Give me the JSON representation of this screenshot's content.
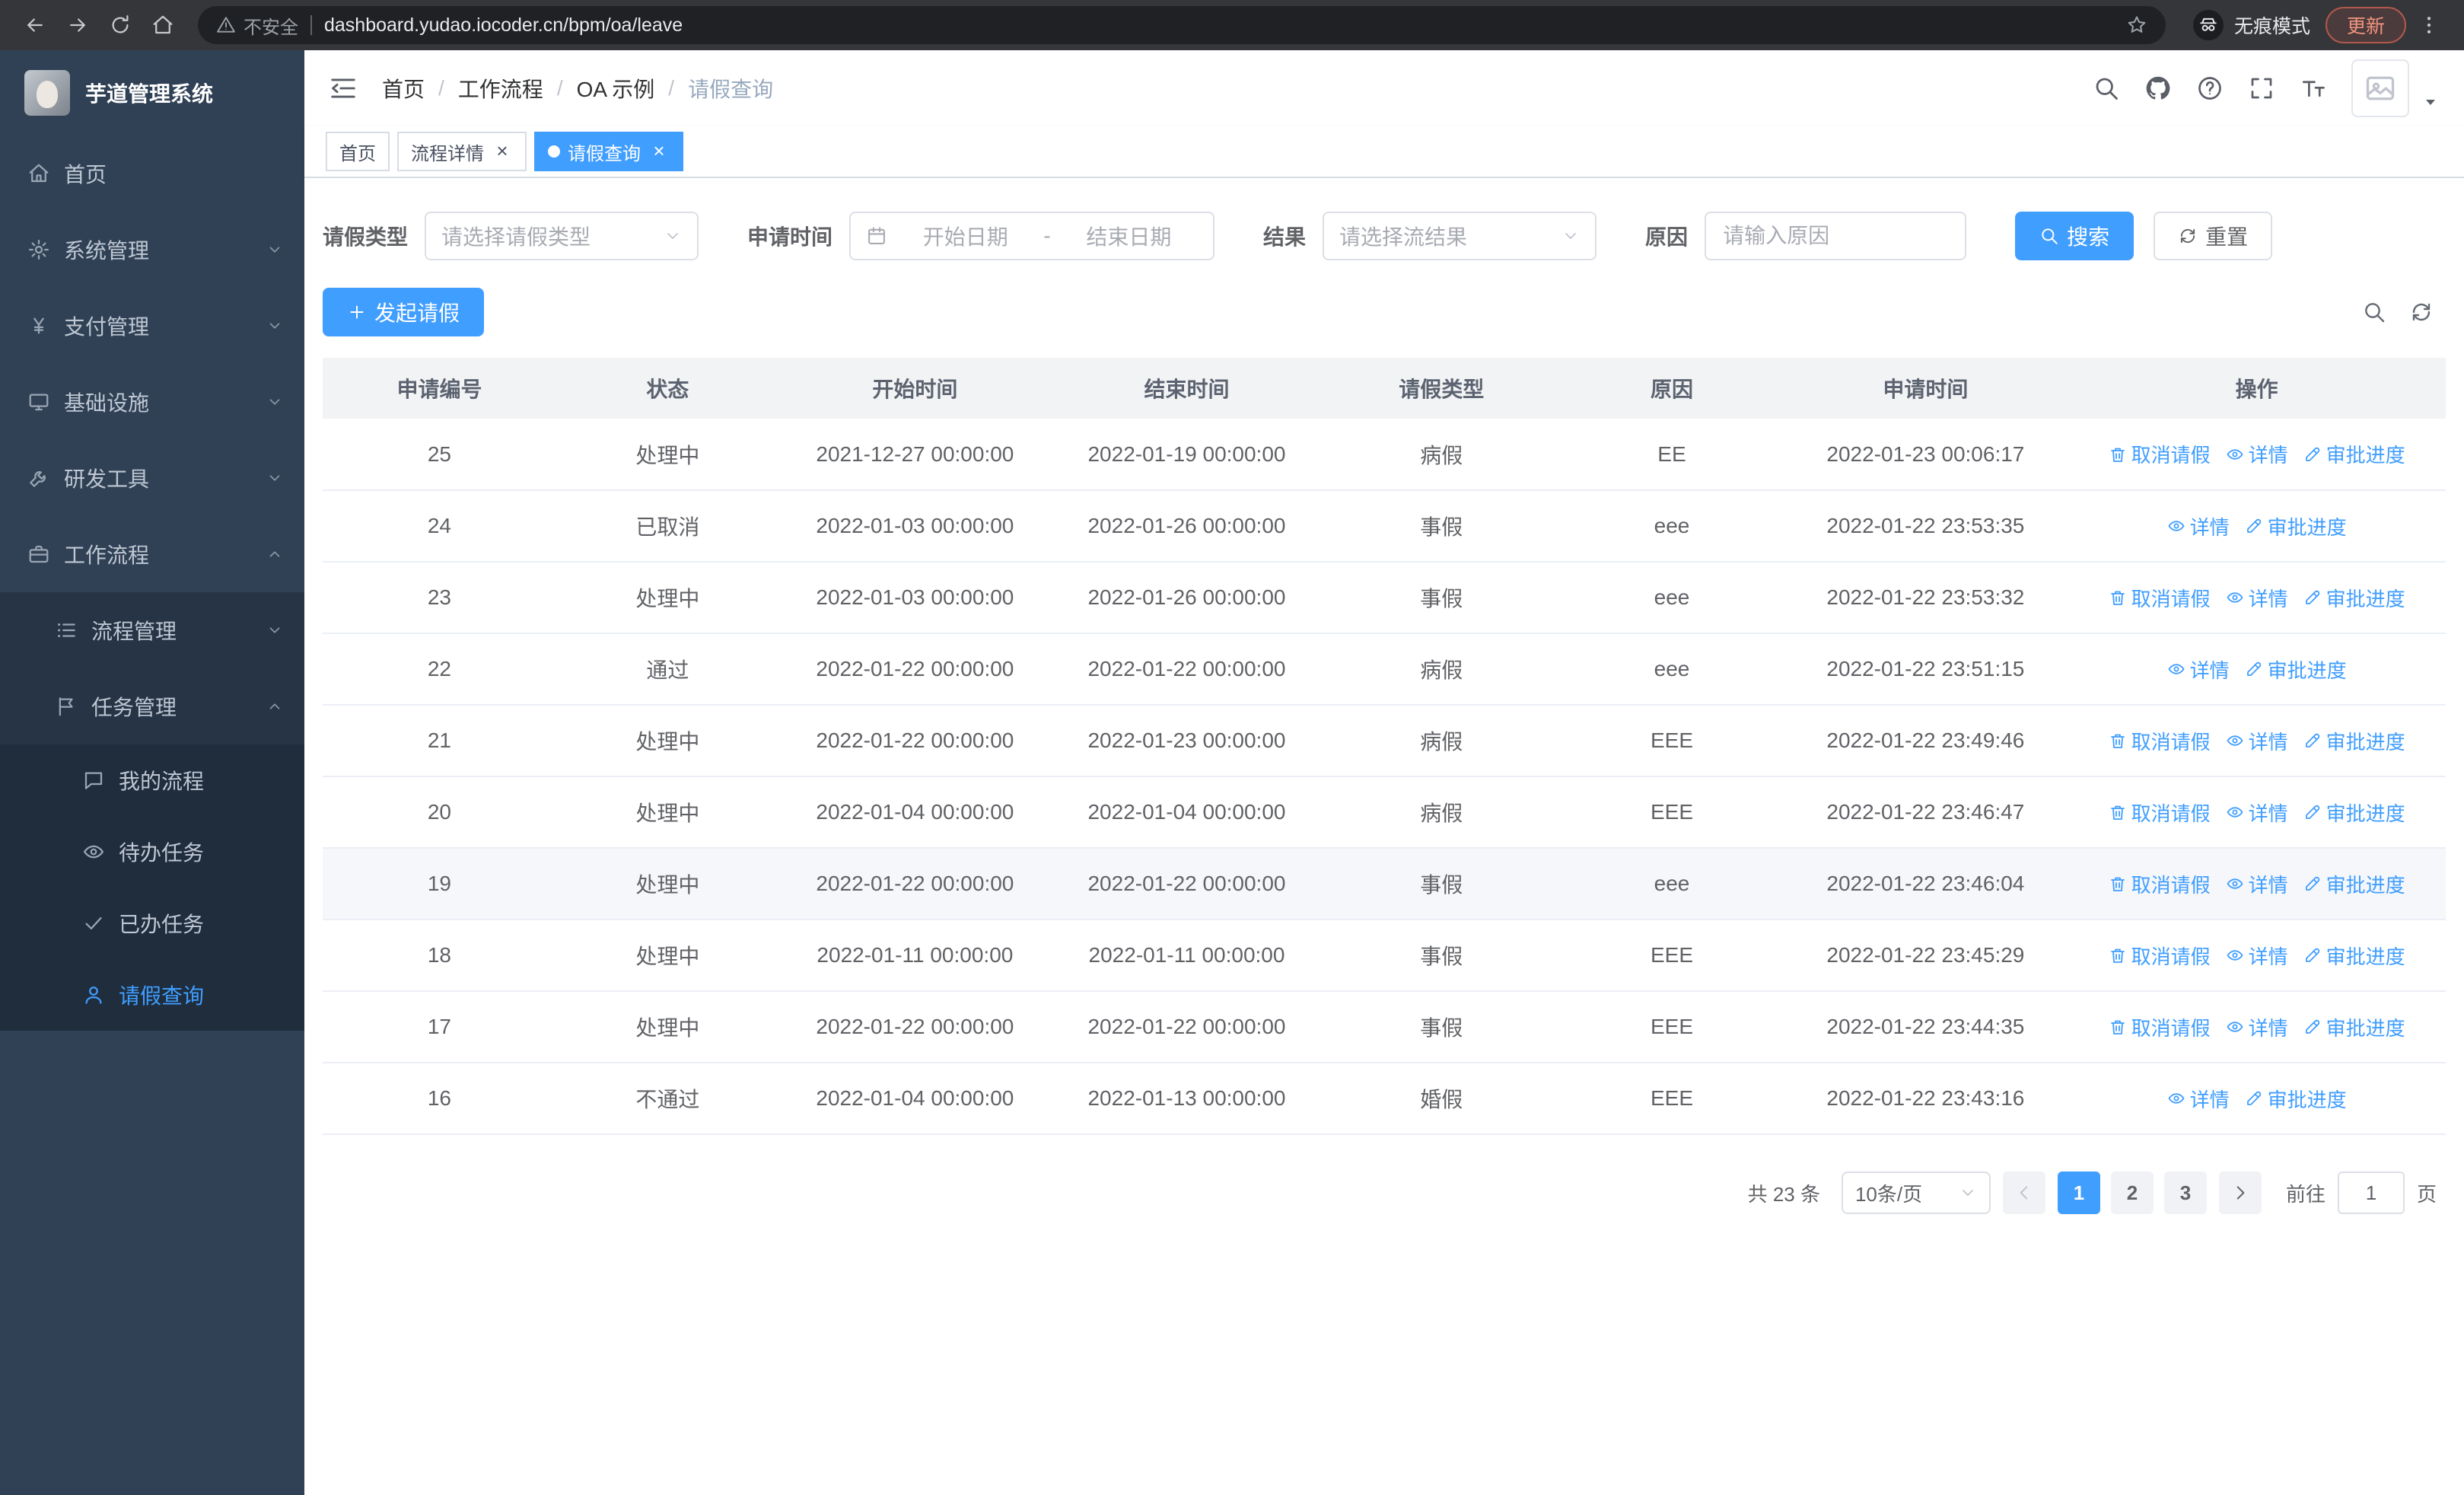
{
  "browser": {
    "warning": "不安全",
    "url": "dashboard.yudao.iocoder.cn/bpm/oa/leave",
    "incognito": "无痕模式",
    "update": "更新"
  },
  "sidebar": {
    "title": "芋道管理系统",
    "menu": [
      {
        "id": "home",
        "label": "首页",
        "icon": "dashboard",
        "level": 1
      },
      {
        "id": "system-mgmt",
        "label": "系统管理",
        "icon": "gear",
        "level": 1,
        "arrow": "down"
      },
      {
        "id": "payment-mgmt",
        "label": "支付管理",
        "icon": "yen",
        "level": 1,
        "arrow": "down"
      },
      {
        "id": "infrastructure",
        "label": "基础设施",
        "icon": "monitor",
        "level": 1,
        "arrow": "down"
      },
      {
        "id": "dev-tools",
        "label": "研发工具",
        "icon": "wrench",
        "level": 1,
        "arrow": "down"
      },
      {
        "id": "workflow",
        "label": "工作流程",
        "icon": "briefcase",
        "level": 1,
        "arrow": "up",
        "open": true
      },
      {
        "id": "process-mgmt",
        "label": "流程管理",
        "icon": "list",
        "level": 2,
        "arrow": "down"
      },
      {
        "id": "task-mgmt",
        "label": "任务管理",
        "icon": "flag",
        "level": 2,
        "arrow": "up",
        "open": true
      },
      {
        "id": "my-process",
        "label": "我的流程",
        "icon": "chat",
        "level": 3
      },
      {
        "id": "todo-tasks",
        "label": "待办任务",
        "icon": "eye",
        "level": 3
      },
      {
        "id": "done-tasks",
        "label": "已办任务",
        "icon": "check",
        "level": 3
      },
      {
        "id": "leave-query",
        "label": "请假查询",
        "icon": "user",
        "level": 3,
        "active": true
      }
    ]
  },
  "navbar": {
    "breadcrumb": [
      "首页",
      "工作流程",
      "OA 示例",
      "请假查询"
    ]
  },
  "tabs": [
    {
      "id": "home",
      "label": "首页",
      "active": false,
      "closable": false
    },
    {
      "id": "process-detail",
      "label": "流程详情",
      "active": false,
      "closable": true
    },
    {
      "id": "leave-query",
      "label": "请假查询",
      "active": true,
      "closable": true
    }
  ],
  "filters": {
    "type_label": "请假类型",
    "type_placeholder": "请选择请假类型",
    "time_label": "申请时间",
    "start_placeholder": "开始日期",
    "range_separator": "-",
    "end_placeholder": "结束日期",
    "result_label": "结果",
    "result_placeholder": "请选择流结果",
    "reason_label": "原因",
    "reason_placeholder": "请输入原因",
    "search": "搜索",
    "reset": "重置"
  },
  "toolbar": {
    "create": "发起请假"
  },
  "table": {
    "columns": [
      "申请编号",
      "状态",
      "开始时间",
      "结束时间",
      "请假类型",
      "原因",
      "申请时间",
      "操作"
    ],
    "action_labels": {
      "cancel": "取消请假",
      "detail": "详情",
      "progress": "审批进度"
    },
    "rows": [
      {
        "id": "25",
        "status": "处理中",
        "start": "2021-12-27 00:00:00",
        "end": "2022-01-19 00:00:00",
        "type": "病假",
        "reason": "EE",
        "applied": "2022-01-23 00:06:17",
        "actions": [
          "cancel",
          "detail",
          "progress"
        ]
      },
      {
        "id": "24",
        "status": "已取消",
        "start": "2022-01-03 00:00:00",
        "end": "2022-01-26 00:00:00",
        "type": "事假",
        "reason": "eee",
        "applied": "2022-01-22 23:53:35",
        "actions": [
          "detail",
          "progress"
        ]
      },
      {
        "id": "23",
        "status": "处理中",
        "start": "2022-01-03 00:00:00",
        "end": "2022-01-26 00:00:00",
        "type": "事假",
        "reason": "eee",
        "applied": "2022-01-22 23:53:32",
        "actions": [
          "cancel",
          "detail",
          "progress"
        ]
      },
      {
        "id": "22",
        "status": "通过",
        "start": "2022-01-22 00:00:00",
        "end": "2022-01-22 00:00:00",
        "type": "病假",
        "reason": "eee",
        "applied": "2022-01-22 23:51:15",
        "actions": [
          "detail",
          "progress"
        ]
      },
      {
        "id": "21",
        "status": "处理中",
        "start": "2022-01-22 00:00:00",
        "end": "2022-01-23 00:00:00",
        "type": "病假",
        "reason": "EEE",
        "applied": "2022-01-22 23:49:46",
        "actions": [
          "cancel",
          "detail",
          "progress"
        ]
      },
      {
        "id": "20",
        "status": "处理中",
        "start": "2022-01-04 00:00:00",
        "end": "2022-01-04 00:00:00",
        "type": "病假",
        "reason": "EEE",
        "applied": "2022-01-22 23:46:47",
        "actions": [
          "cancel",
          "detail",
          "progress"
        ]
      },
      {
        "id": "19",
        "status": "处理中",
        "start": "2022-01-22 00:00:00",
        "end": "2022-01-22 00:00:00",
        "type": "事假",
        "reason": "eee",
        "applied": "2022-01-22 23:46:04",
        "actions": [
          "cancel",
          "detail",
          "progress"
        ],
        "highlight": true
      },
      {
        "id": "18",
        "status": "处理中",
        "start": "2022-01-11 00:00:00",
        "end": "2022-01-11 00:00:00",
        "type": "事假",
        "reason": "EEE",
        "applied": "2022-01-22 23:45:29",
        "actions": [
          "cancel",
          "detail",
          "progress"
        ]
      },
      {
        "id": "17",
        "status": "处理中",
        "start": "2022-01-22 00:00:00",
        "end": "2022-01-22 00:00:00",
        "type": "事假",
        "reason": "EEE",
        "applied": "2022-01-22 23:44:35",
        "actions": [
          "cancel",
          "detail",
          "progress"
        ]
      },
      {
        "id": "16",
        "status": "不通过",
        "start": "2022-01-04 00:00:00",
        "end": "2022-01-13 00:00:00",
        "type": "婚假",
        "reason": "EEE",
        "applied": "2022-01-22 23:43:16",
        "actions": [
          "detail",
          "progress"
        ]
      }
    ]
  },
  "pagination": {
    "total": "共 23 条",
    "page_size": "10条/页",
    "pages": [
      "1",
      "2",
      "3"
    ],
    "active_page": "1",
    "goto_label": "前往",
    "goto_value": "1",
    "unit": "页"
  },
  "colors": {
    "primary": "#409eff",
    "sidebar_bg": "#304156",
    "chrome_bg": "#35363a"
  }
}
